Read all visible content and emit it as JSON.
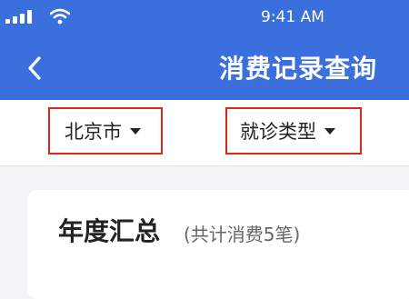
{
  "status_bar": {
    "time": "9:41 AM",
    "signal_icon": "signal-bars-icon",
    "wifi_icon": "wifi-icon"
  },
  "header": {
    "back_icon": "chevron-left-icon",
    "title": "消费记录查询"
  },
  "filters": {
    "city": {
      "label": "北京市",
      "icon": "caret-down-icon"
    },
    "visit_type": {
      "label": "就诊类型",
      "icon": "caret-down-icon"
    }
  },
  "summary": {
    "title": "年度汇总",
    "subtitle": "(共计消费5笔)"
  },
  "colors": {
    "header_background": "#3b6fde",
    "highlight_border": "#e1251b",
    "page_background": "#f3f4f6"
  }
}
